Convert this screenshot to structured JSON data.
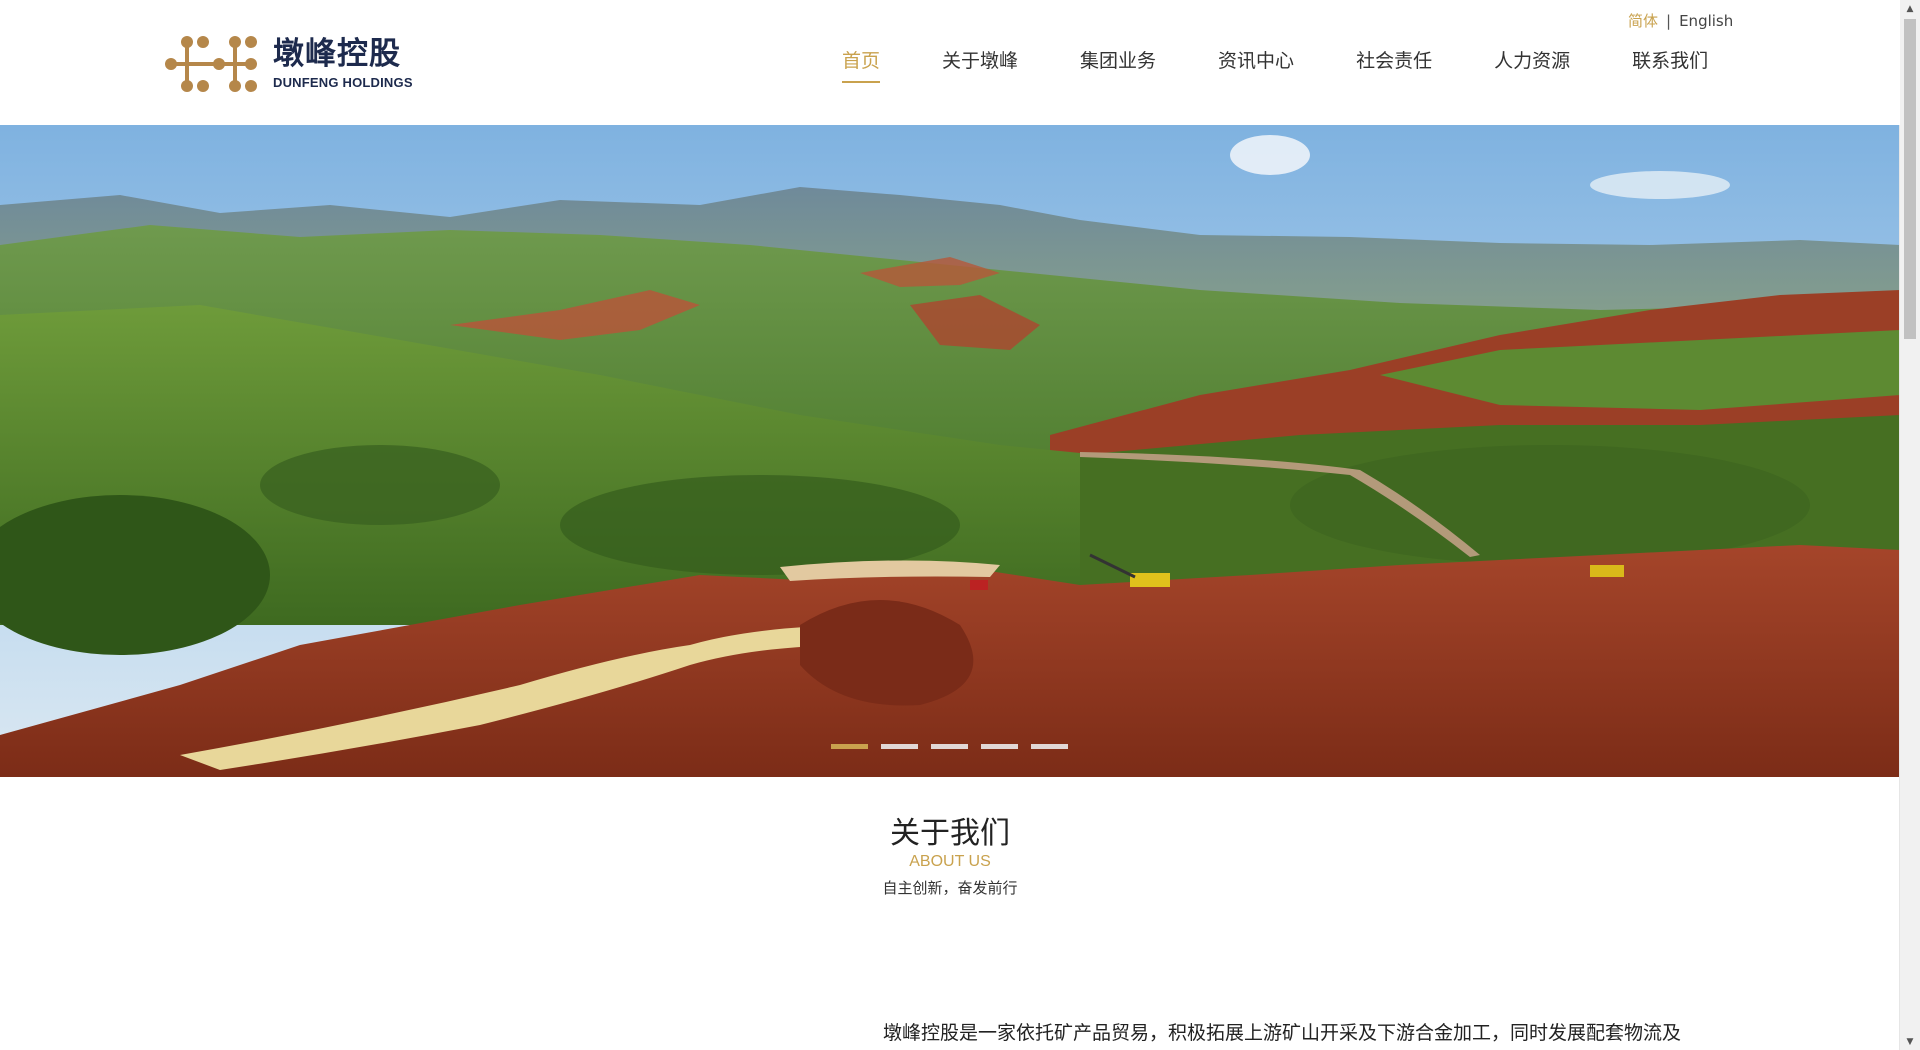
{
  "brand": {
    "name_cn": "墩峰控股",
    "name_en": "DUNFENG HOLDINGS",
    "logo_icon": "dunfeng-dots-logo",
    "color": "#b5874a"
  },
  "lang": {
    "simplified": "简体",
    "separator": "|",
    "english": "English"
  },
  "nav": {
    "items": [
      {
        "label": "首页"
      },
      {
        "label": "关于墩峰"
      },
      {
        "label": "集团业务"
      },
      {
        "label": "资讯中心"
      },
      {
        "label": "社会责任"
      },
      {
        "label": "人力资源"
      },
      {
        "label": "联系我们"
      }
    ],
    "active_index": 0
  },
  "banner": {
    "image": "mining-landscape",
    "slides": 5,
    "active_slide": 0
  },
  "about": {
    "title": "关于我们",
    "subtitle": "ABOUT US",
    "tagline": "自主创新，奋发前行",
    "body": "墩峰控股是一家依托矿产品贸易，积极拓展上游矿山开采及下游合金加工，同时发展配套物流及"
  },
  "colors": {
    "accent": "#c9a24e",
    "text": "#222222",
    "logo_navy": "#1d2a4d"
  },
  "icons": {
    "scroll_up": "arrow-up-icon",
    "scroll_down": "arrow-down-icon"
  }
}
